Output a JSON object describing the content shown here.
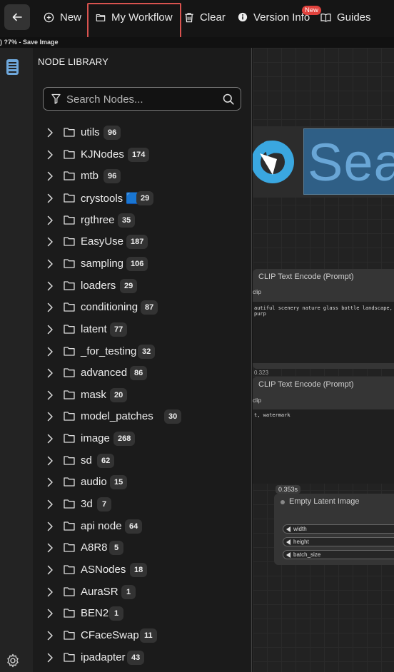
{
  "topbar": {
    "new_label": "New",
    "workflow_label": "My Workflow",
    "clear_label": "Clear",
    "version_label": "Version Info",
    "version_badge": "New",
    "guides_label": "Guides"
  },
  "status_text": ") ?7% - Save Image",
  "panel": {
    "title": "NODE LIBRARY",
    "search_placeholder": "Search Nodes..."
  },
  "tree": [
    {
      "label": "utils",
      "count": "96"
    },
    {
      "label": "KJNodes",
      "count": "174"
    },
    {
      "label": "mtb",
      "count": "96"
    },
    {
      "label": "crystools 🟦",
      "count": "29"
    },
    {
      "label": "rgthree",
      "count": "35"
    },
    {
      "label": "EasyUse",
      "count": "187"
    },
    {
      "label": "sampling",
      "count": "106"
    },
    {
      "label": "loaders",
      "count": "29"
    },
    {
      "label": "conditioning",
      "count": "87"
    },
    {
      "label": "latent",
      "count": "77"
    },
    {
      "label": "_for_testing",
      "count": "32"
    },
    {
      "label": "advanced",
      "count": "86"
    },
    {
      "label": "mask",
      "count": "20"
    },
    {
      "label": "model_patches",
      "count": "30"
    },
    {
      "label": "image",
      "count": "268"
    },
    {
      "label": "sd",
      "count": "62"
    },
    {
      "label": "audio",
      "count": "15"
    },
    {
      "label": "3d",
      "count": "7"
    },
    {
      "label": "api node",
      "count": "64"
    },
    {
      "label": "A8R8",
      "count": "5"
    },
    {
      "label": "ASNodes",
      "count": "18"
    },
    {
      "label": "AuraSR",
      "count": "1"
    },
    {
      "label": "BEN2",
      "count": "1"
    },
    {
      "label": "CFaceSwap",
      "count": "11"
    },
    {
      "label": "ipadapter",
      "count": "43"
    }
  ],
  "canvas": {
    "logo_text": "Sea",
    "node1": {
      "title": "CLIP Text Encode (Prompt)",
      "input": "clip",
      "text": "autiful scenery nature glass bottle landscape, , purp"
    },
    "time1": "0.323",
    "node2": {
      "title": "CLIP Text Encode (Prompt)",
      "input": "clip",
      "text": "t, watermark"
    },
    "time2": "0.353s",
    "node3": {
      "title": "Empty Latent Image",
      "widgets": [
        "width",
        "height",
        "batch_size"
      ]
    }
  },
  "colors": {
    "accent": "#6fa8dc",
    "highlight": "#d9534f",
    "badge_red": "#e0423d"
  }
}
